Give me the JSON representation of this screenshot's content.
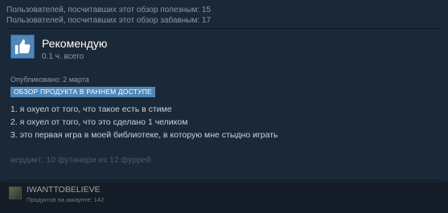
{
  "stats": {
    "helpful": "Пользователей, посчитавших этот обзор полезным: 15",
    "funny": "Пользователей, посчитавших этот обзор забавным: 17"
  },
  "recommendation": {
    "icon": "thumbs-up-icon",
    "title": "Рекомендую",
    "hours": "0.1 ч. всего"
  },
  "review": {
    "posted": "Опубликовано: 2 марта",
    "early_access_badge": "ОБЗОР ПРОДУКТА В РАННЕМ ДОСТУПЕ",
    "lines": [
      "1. я охуел от того, что такое есть в стиме",
      "2. я охуел от того, что это сделано 1 челиком",
      "3. это первая игра в моей библиотеке, в которую мне стыдно играть"
    ],
    "verdict": "вердикт: 10 футанари из 12 фуррей"
  },
  "author": {
    "name": "IWANTTOBELIEVE",
    "products": "Продуктов на аккаунте: 142"
  },
  "colors": {
    "background": "#1b2838",
    "accent": "#4f88b8",
    "footer": "#141d27"
  }
}
